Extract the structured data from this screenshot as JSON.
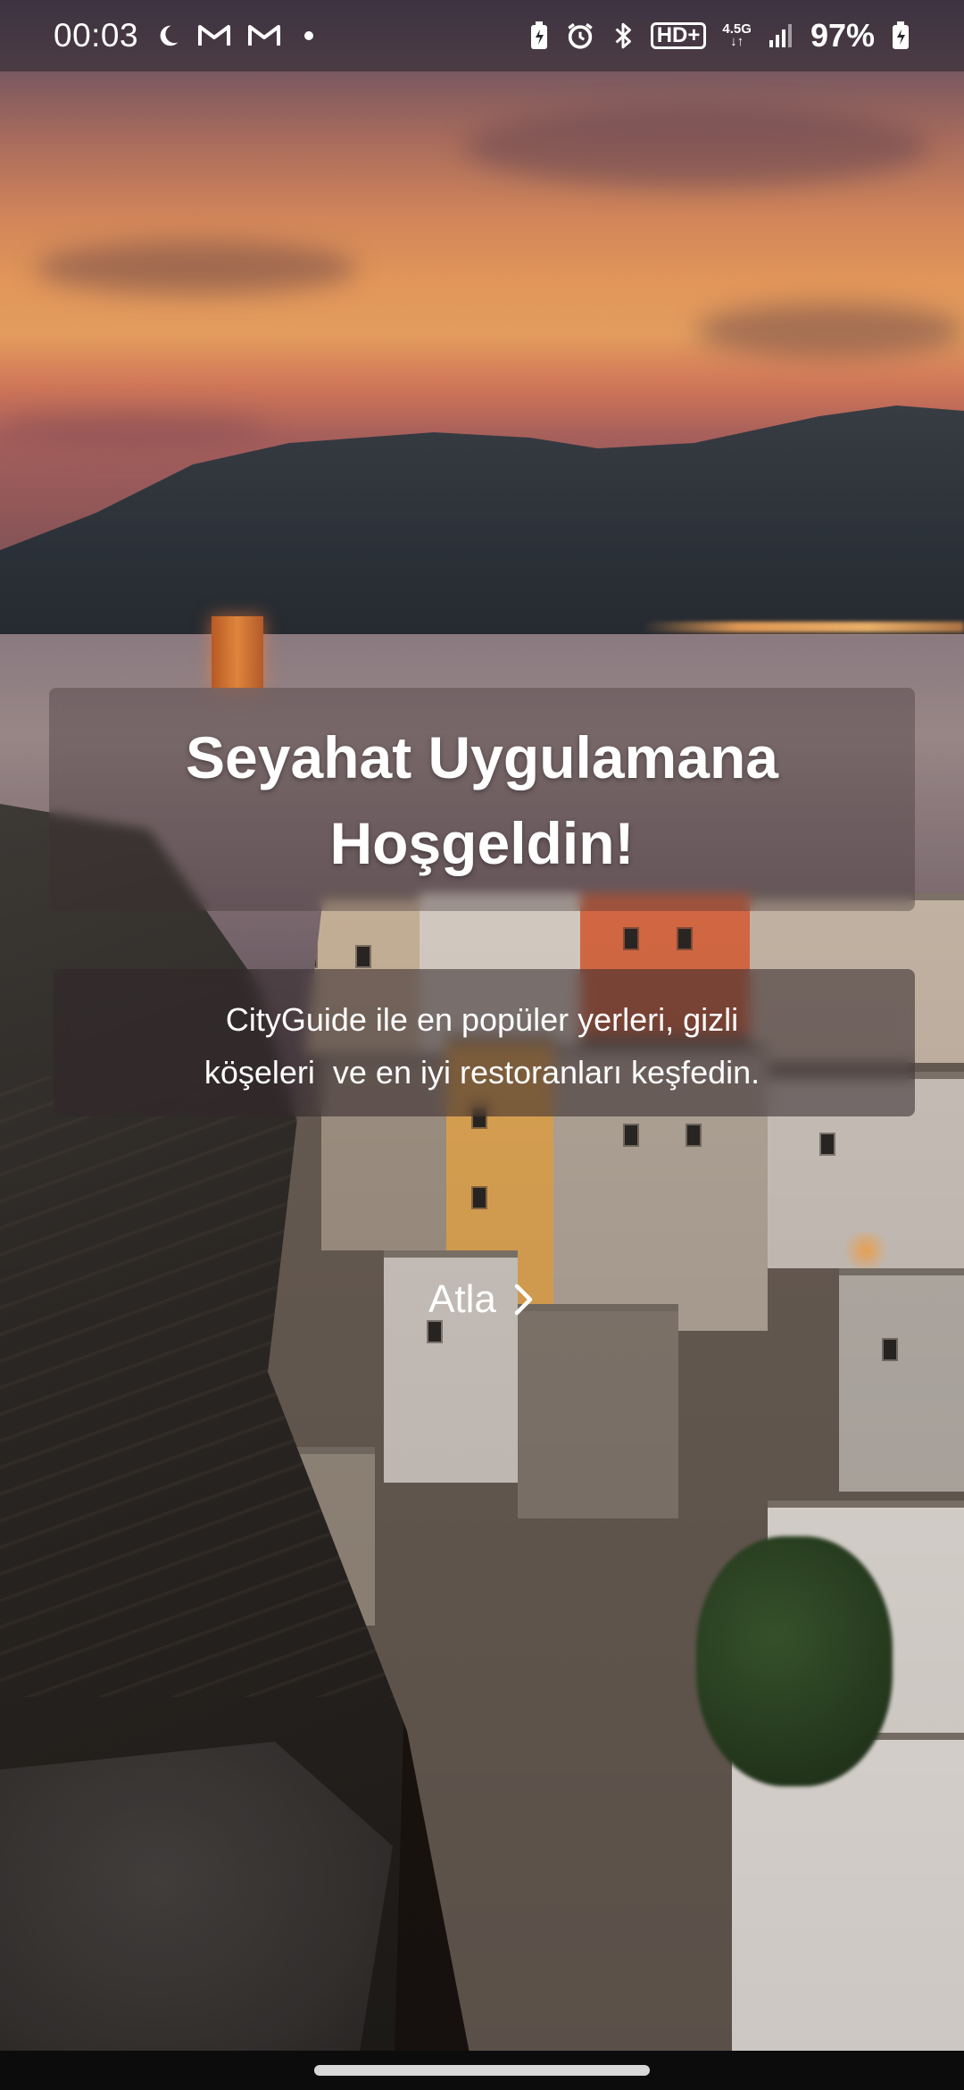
{
  "status_bar": {
    "time": "00:03",
    "left_icons": [
      "moon-icon",
      "gmail-icon",
      "gmail-icon",
      "notification-dot-icon"
    ],
    "right_icons": [
      "battery-saver-icon",
      "alarm-icon",
      "bluetooth-icon",
      "hd-voice-icon",
      "network-type-icon",
      "signal-icon",
      "battery-charging-icon"
    ],
    "hd_label": "HD+",
    "network_label": "4.5G",
    "battery_percent": "97%"
  },
  "welcome": {
    "title_line1": "Seyahat Uygulamana",
    "title_line2": "Hoşgeldin!",
    "description_line1": "CityGuide ile en popüler yerleri, gizli",
    "description_line2": "köşeleri  ve en iyi restoranları keşfedin.",
    "skip_label": "Atla"
  },
  "colors": {
    "text": "#ffffff",
    "status_bar_bg": "#28242c",
    "nav_bar_bg": "#0c0c0c"
  }
}
